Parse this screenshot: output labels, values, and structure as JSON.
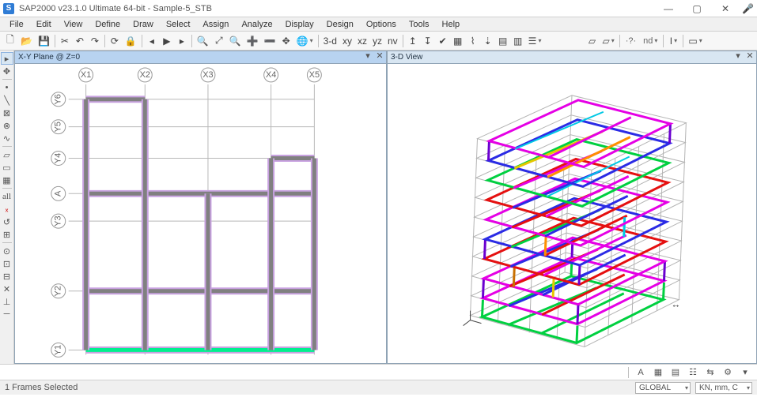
{
  "title": "SAP2000 v23.1.0 Ultimate 64-bit - Sample-5_STB",
  "menu": [
    "File",
    "Edit",
    "View",
    "Define",
    "Draw",
    "Select",
    "Assign",
    "Analyze",
    "Display",
    "Design",
    "Options",
    "Tools",
    "Help"
  ],
  "toolbar1": {
    "btns_a": [
      "new",
      "open",
      "save",
      "print",
      "undo",
      "redo",
      "refresh",
      "lock",
      "run-back",
      "run",
      "run-fwd"
    ],
    "btns_b": [
      "zoom-window",
      "zoom-extents",
      "zoom-prev",
      "zoom-in",
      "zoom-out",
      "pan",
      "rotate-3d"
    ],
    "view_btns": {
      "threeD": "3-d",
      "xy": "xy",
      "xz": "xz",
      "yz": "yz",
      "nv": "nv"
    },
    "btns_c": [
      "up-story",
      "down-story",
      "set-disp",
      "show-undeformed",
      "deformed",
      "joint-load",
      "frame-load",
      "area-load",
      "named-display"
    ]
  },
  "toolbar2": {
    "btns": [
      "section-cut",
      "snap",
      "bracket"
    ],
    "sel_show": "·?·",
    "nd_label": "nd",
    "dim": "I",
    "ext": "▭"
  },
  "left_pane": {
    "title": "X-Y Plane @ Z=0",
    "grid_x": [
      "X1",
      "X2",
      "X3",
      "X4",
      "X5"
    ],
    "grid_y": [
      "Y1",
      "Y2",
      "Y3",
      "A",
      "Y4",
      "Y5",
      "Y6"
    ]
  },
  "right_pane": {
    "title": "3-D View"
  },
  "status": {
    "left": "1 Frames Selected",
    "coord_sys": "GLOBAL",
    "units": "KN, mm, C"
  }
}
